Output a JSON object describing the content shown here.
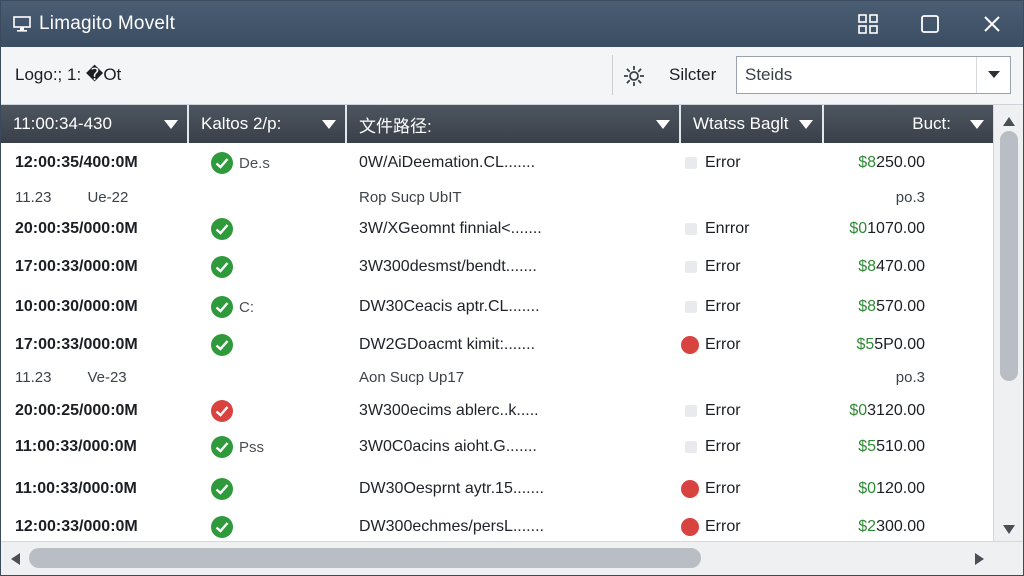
{
  "window": {
    "title": "Limagito Movelt"
  },
  "toolbar": {
    "logo_label": "Logo:; 1: �Ot",
    "filter_label": "Silcter",
    "filter_value": "Steids"
  },
  "table": {
    "headers": [
      "11:00:34-430",
      "Kaltos 2/p:",
      "文件路径:",
      "Wtatss Baglt",
      "Buct:"
    ],
    "rows": [
      {
        "kind": "main",
        "time": "12:00:35/400:0M",
        "status": "ok",
        "status_text": "De.s",
        "path": "0W/AiDeemation.CL.......",
        "bag": "plain",
        "bag_text": "Error",
        "amount_cur": "$8",
        "amount_rest": "250.00"
      },
      {
        "kind": "sub",
        "date": "11.23",
        "code": "Ue-22",
        "note": "Rop Sucp  UbIT",
        "po": "po.3"
      },
      {
        "kind": "main",
        "time": "20:00:35/000:0M",
        "status": "ok",
        "status_text": "",
        "path": "3W/XGeomnt finnial<.......",
        "bag": "plain",
        "bag_text": "Enrror",
        "amount_cur": "$0",
        "amount_rest": "1070.00"
      },
      {
        "kind": "main",
        "time": "17:00:33/000:0M",
        "status": "ok",
        "status_text": "",
        "path": "3W300desmst/bendt.......",
        "bag": "plain",
        "bag_text": "Error",
        "amount_cur": "$8",
        "amount_rest": "470.00"
      },
      {
        "kind": "main",
        "time": "10:00:30/000:0M",
        "status": "ok",
        "status_text": "C:",
        "path": "DW30Ceacis aptr.CL.......",
        "bag": "plain",
        "bag_text": "Error",
        "amount_cur": "$8",
        "amount_rest": "570.00"
      },
      {
        "kind": "main",
        "time": "17:00:33/000:0M",
        "status": "ok",
        "status_text": "",
        "path": "DW2GDoacmt kimit:.......",
        "bag": "red",
        "bag_text": "Error",
        "amount_cur": "$5",
        "amount_rest": "5P0.00"
      },
      {
        "kind": "sub",
        "date": "11.23",
        "code": "Ve-23",
        "note": "Aon Sucp  Up17",
        "po": "po.3"
      },
      {
        "kind": "main",
        "time": "20:00:25/000:0M",
        "status": "bad",
        "status_text": "",
        "path": "3W300ecims ablerc..k.....",
        "bag": "plain",
        "bag_text": "Error",
        "amount_cur": "$0",
        "amount_rest": "3120.00"
      },
      {
        "kind": "main",
        "time": "11:00:33/000:0M",
        "status": "ok",
        "status_text": "Pss",
        "path": "3W0C0acins aioht.G.......",
        "bag": "plain",
        "bag_text": "Error",
        "amount_cur": "$5",
        "amount_rest": "510.00"
      },
      {
        "kind": "main",
        "time": "11:00:33/000:0M",
        "status": "ok",
        "status_text": "",
        "path": "DW30Oesprnt aytr.15.......",
        "bag": "red",
        "bag_text": "Error",
        "amount_cur": "$0",
        "amount_rest": "120.00"
      },
      {
        "kind": "main",
        "time": "12:00:33/000:0M",
        "status": "ok",
        "status_text": "",
        "path": "DW300echmes/persL.......",
        "bag": "red",
        "bag_text": "Error",
        "amount_cur": "$2",
        "amount_rest": "300.00"
      }
    ]
  },
  "icons": {
    "title": "monitor-icon",
    "filter": "gear-filter-icon",
    "status_ok": "check-circle-icon",
    "status_bad": "check-circle-red-icon"
  },
  "colors": {
    "titlebar": "#3b4d62",
    "header": "#3a4049",
    "ok": "#2f9a3c",
    "error": "#d9433f",
    "currency": "#2f8a35"
  }
}
